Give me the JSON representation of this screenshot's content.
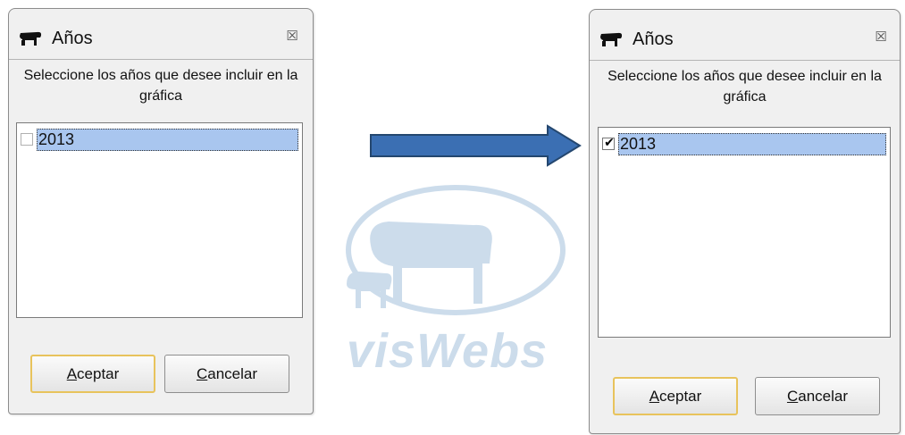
{
  "colors": {
    "selection": "#a9c6ef",
    "arrow_fill": "#3b6fb3",
    "arrow_stroke": "#24476f",
    "default_button_border": "#e8c35c",
    "watermark": "#1a63a8"
  },
  "dialog_before": {
    "title": "Años",
    "title_icon": "sheep-icon",
    "close_glyph": "☒",
    "prompt": "Seleccione los años que desee incluir en la gráfica",
    "items": [
      {
        "label": "2013",
        "checked": false
      }
    ],
    "accept_accel": "A",
    "accept_rest": "ceptar",
    "cancel_accel": "C",
    "cancel_rest": "ancelar"
  },
  "dialog_after": {
    "title": "Años",
    "title_icon": "sheep-icon",
    "close_glyph": "☒",
    "prompt": "Seleccione los años que desee incluir en la gráfica",
    "items": [
      {
        "label": "2013",
        "checked": true,
        "mark": "✔"
      }
    ],
    "accept_accel": "A",
    "accept_rest": "ceptar",
    "cancel_accel": "C",
    "cancel_rest": "ancelar"
  },
  "watermark": {
    "text": "visWebs"
  }
}
